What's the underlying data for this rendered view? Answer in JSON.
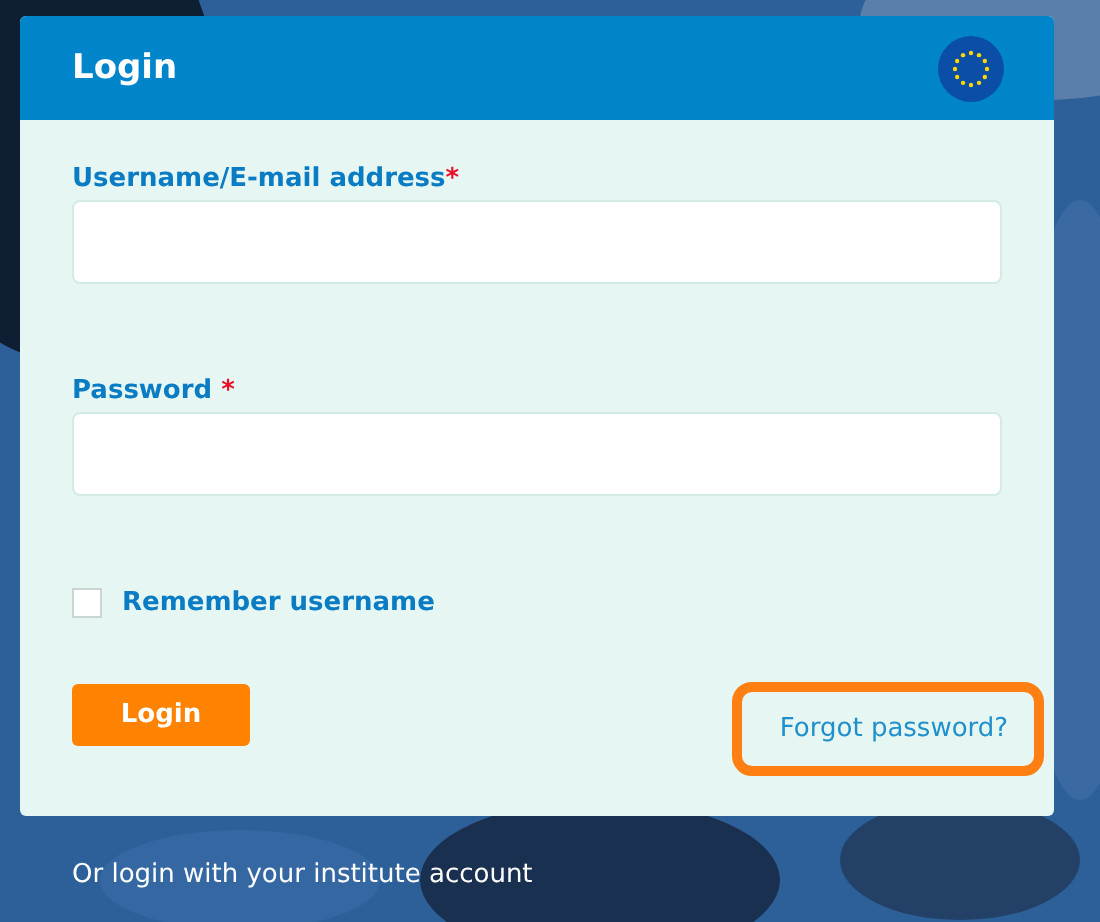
{
  "card": {
    "title": "Login"
  },
  "fields": [
    {
      "label": "Username/E-mail address",
      "required_mark": "*"
    },
    {
      "label": "Password",
      "required_mark": " *"
    }
  ],
  "remember": {
    "label": "Remember username",
    "checked": false
  },
  "login_button": "Login",
  "forgot_link": "Forgot password?",
  "footer_link": "Or login with your institute account"
}
